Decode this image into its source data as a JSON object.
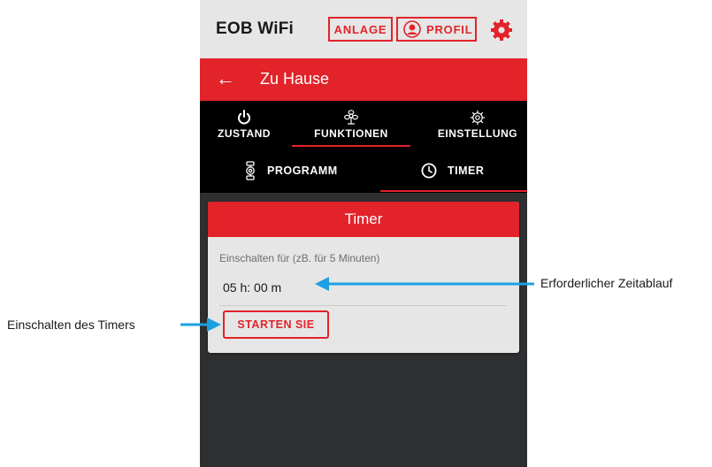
{
  "app": {
    "brand": "EOB WiFi",
    "anlage_label": "ANLAGE",
    "profil_label": "PROFIL"
  },
  "header": {
    "title": "Zu Hause"
  },
  "main_tabs": [
    {
      "label": "ZUSTAND",
      "icon": "power-icon"
    },
    {
      "label": "FUNKTIONEN",
      "icon": "fan-icon"
    },
    {
      "label": "EINSTELLUNG",
      "icon": "gear-icon"
    }
  ],
  "sub_tabs": [
    {
      "label": "PROGRAMM",
      "icon": "heater-icon"
    },
    {
      "label": "TIMER",
      "icon": "clock-icon"
    }
  ],
  "timer_card": {
    "title": "Timer",
    "label": "Einschalten für (zB. für 5 Minuten)",
    "value": "05 h: 00 m",
    "start_label": "STARTEN SIE"
  },
  "annotations": {
    "left": "Einschalten des Timers",
    "right": "Erforderlicher Zeitablauf"
  },
  "colors": {
    "accent": "#e2232a",
    "arrow": "#1ba1e2",
    "dark": "#2e2f31"
  }
}
